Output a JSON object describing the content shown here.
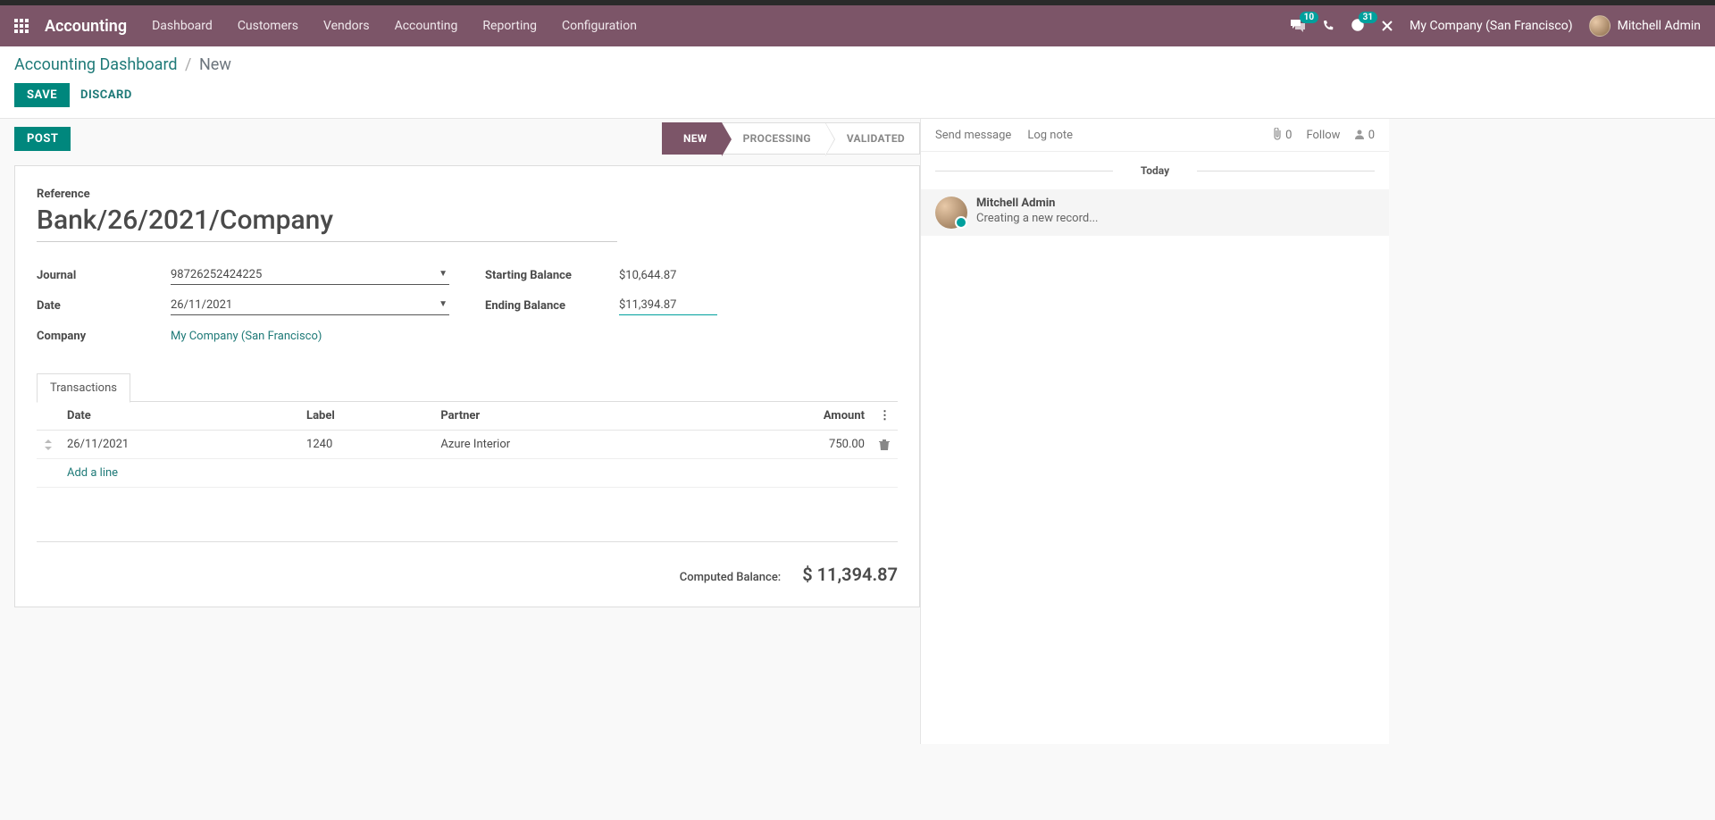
{
  "nav": {
    "brand": "Accounting",
    "items": [
      "Dashboard",
      "Customers",
      "Vendors",
      "Accounting",
      "Reporting",
      "Configuration"
    ],
    "msg_badge": "10",
    "clock_badge": "31",
    "company": "My Company (San Francisco)",
    "user": "Mitchell Admin"
  },
  "breadcrumb": {
    "parent": "Accounting Dashboard",
    "current": "New"
  },
  "buttons": {
    "save": "SAVE",
    "discard": "DISCARD",
    "post": "POST"
  },
  "status": {
    "new": "NEW",
    "processing": "PROCESSING",
    "validated": "VALIDATED"
  },
  "form": {
    "reference_label": "Reference",
    "reference_value": "Bank/26/2021/Company",
    "journal_label": "Journal",
    "journal_value": "98726252424225",
    "date_label": "Date",
    "date_value": "26/11/2021",
    "company_label": "Company",
    "company_value": "My Company (San Francisco)",
    "start_bal_label": "Starting Balance",
    "start_bal_value": "$10,644.87",
    "end_bal_label": "Ending Balance",
    "end_bal_value": "$11,394.87"
  },
  "tab": {
    "transactions": "Transactions"
  },
  "tx": {
    "headers": {
      "date": "Date",
      "label": "Label",
      "partner": "Partner",
      "amount": "Amount"
    },
    "rows": [
      {
        "date": "26/11/2021",
        "label": "1240",
        "partner": "Azure Interior",
        "amount": "750.00"
      }
    ],
    "add_line": "Add a line",
    "computed_label": "Computed Balance:",
    "computed_value": "$ 11,394.87"
  },
  "chatter": {
    "send": "Send message",
    "log": "Log note",
    "attach_count": "0",
    "follow": "Follow",
    "follow_count": "0",
    "today": "Today",
    "author": "Mitchell Admin",
    "text": "Creating a new record..."
  }
}
